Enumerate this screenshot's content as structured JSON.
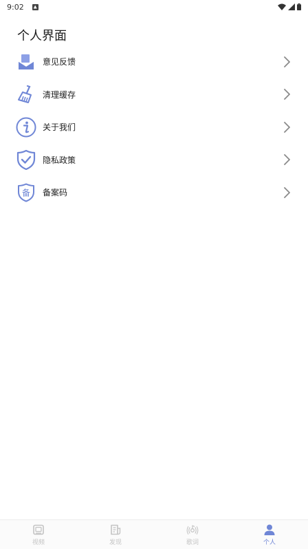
{
  "status_bar": {
    "time": "9:02",
    "icons": [
      "notification-icon",
      "wifi-icon",
      "signal-icon",
      "battery-icon"
    ]
  },
  "page": {
    "title": "个人界面"
  },
  "menu": [
    {
      "label": "意见反馈",
      "icon": "feedback-mail-icon"
    },
    {
      "label": "清理缓存",
      "icon": "broom-icon"
    },
    {
      "label": "关于我们",
      "icon": "info-icon"
    },
    {
      "label": "隐私政策",
      "icon": "shield-check-icon"
    },
    {
      "label": "备案码",
      "icon": "record-shield-icon",
      "icon_text": "备"
    }
  ],
  "bottom_nav": [
    {
      "label": "视频",
      "icon": "video-icon",
      "active": false
    },
    {
      "label": "发现",
      "icon": "discover-icon",
      "active": false
    },
    {
      "label": "歌词",
      "icon": "lyrics-icon",
      "active": false
    },
    {
      "label": "个人",
      "icon": "person-icon",
      "active": true
    }
  ],
  "colors": {
    "accent": "#6f86d6",
    "inactive": "#c4c4c4",
    "text": "#222222",
    "arrow": "#8a8a8a"
  }
}
